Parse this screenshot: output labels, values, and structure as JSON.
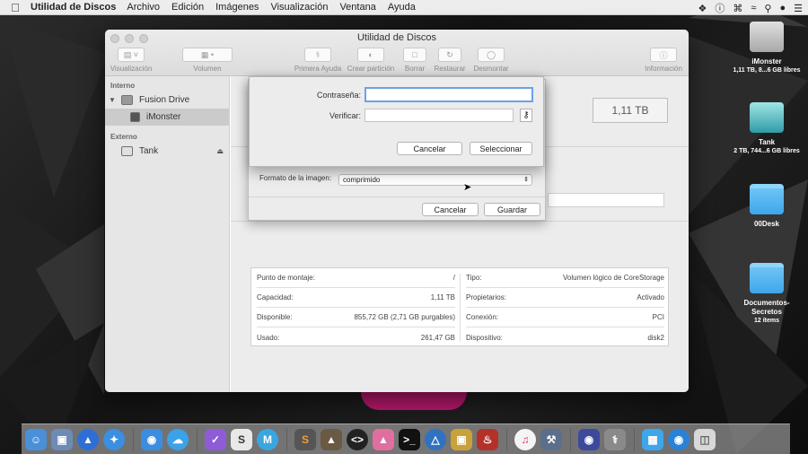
{
  "menubar": {
    "app_name": "Utilidad de Discos",
    "menus": [
      "Archivo",
      "Edición",
      "Imágenes",
      "Visualización",
      "Ventana",
      "Ayuda"
    ]
  },
  "window": {
    "title": "Utilidad de Discos",
    "toolbar": {
      "view": "Visualización",
      "volume": "Volumen",
      "first_aid": "Primera Ayuda",
      "partition": "Crear partición",
      "erase": "Borrar",
      "restore": "Restaurar",
      "unmount": "Desmontar",
      "info": "Información"
    },
    "sidebar": {
      "internal_header": "Interno",
      "internal_disk": "Fusion Drive",
      "internal_volume": "iMonster",
      "external_header": "Externo",
      "external_disk": "Tank"
    },
    "capacity": "1,11 TB",
    "info": {
      "left": [
        {
          "label": "Punto de montaje:",
          "value": "/"
        },
        {
          "label": "Capacidad:",
          "value": "1,11 TB"
        },
        {
          "label": "Disponible:",
          "value": "855,72 GB (2,71 GB purgables)"
        },
        {
          "label": "Usado:",
          "value": "261,47 GB"
        }
      ],
      "right": [
        {
          "label": "Tipo:",
          "value": "Volumen lógico de CoreStorage"
        },
        {
          "label": "Propietarios:",
          "value": "Activado"
        },
        {
          "label": "Conexión:",
          "value": "PCI"
        },
        {
          "label": "Dispositivo:",
          "value": "disk2"
        }
      ]
    }
  },
  "save_sheet": {
    "format_label": "Formato de la imagen:",
    "format_value": "comprimido",
    "cancel": "Cancelar",
    "save": "Guardar"
  },
  "password_sheet": {
    "password_label": "Contraseña:",
    "verify_label": "Verificar:",
    "password_value": "",
    "verify_value": "",
    "cancel": "Cancelar",
    "select": "Seleccionar"
  },
  "desktop": {
    "imonster": {
      "name": "iMonster",
      "sub": "1,11 TB, 8...6 GB libres"
    },
    "tank": {
      "name": "Tank",
      "sub": "2 TB, 744...6 GB libres"
    },
    "desk": {
      "name": "00Desk"
    },
    "docs": {
      "name": "Documentos-\nSecretos",
      "sub": "12 ítems"
    }
  },
  "colors": {
    "accent": "#6aa2e8",
    "folder": "#4fb2ef",
    "highlight": "#b7186c"
  }
}
